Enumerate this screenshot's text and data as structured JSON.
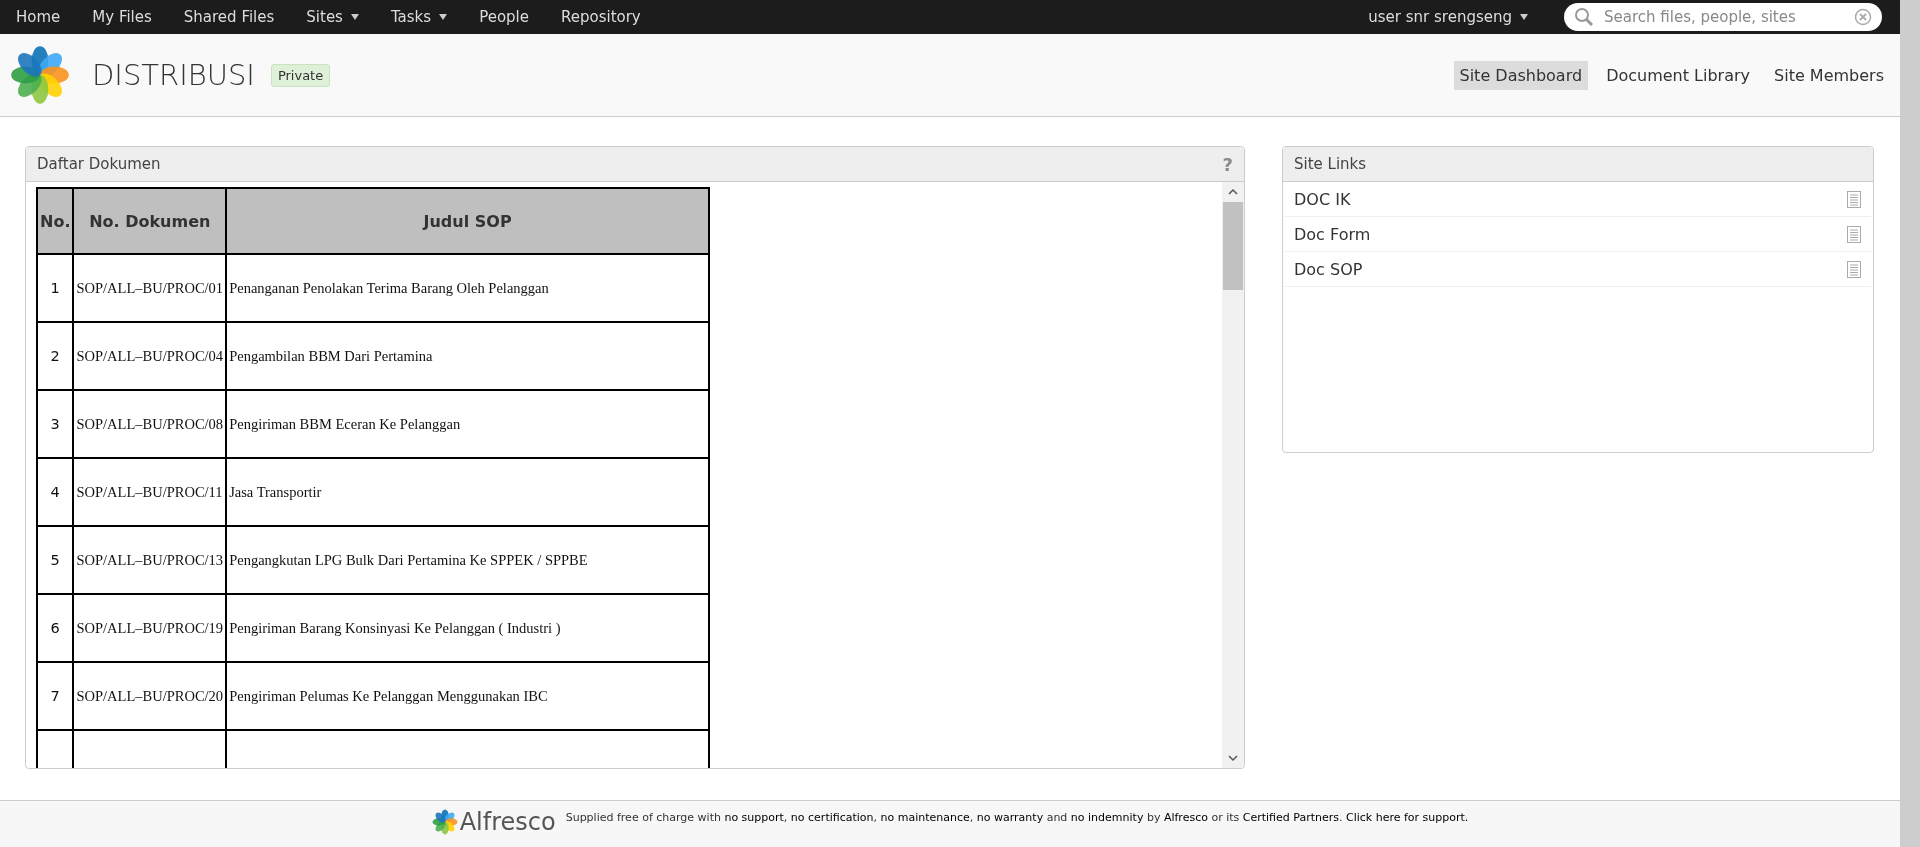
{
  "top_nav": {
    "items": [
      {
        "label": "Home",
        "dropdown": false
      },
      {
        "label": "My Files",
        "dropdown": false
      },
      {
        "label": "Shared Files",
        "dropdown": false
      },
      {
        "label": "Sites",
        "dropdown": true
      },
      {
        "label": "Tasks",
        "dropdown": true
      },
      {
        "label": "People",
        "dropdown": false
      },
      {
        "label": "Repository",
        "dropdown": false
      }
    ],
    "user": {
      "label": "user snr srengseng",
      "dropdown": true
    },
    "search": {
      "placeholder": "Search files, people, sites"
    }
  },
  "site_header": {
    "title": "DISTRIBUSI",
    "visibility": "Private",
    "nav": [
      {
        "label": "Site Dashboard",
        "selected": true
      },
      {
        "label": "Document Library",
        "selected": false
      },
      {
        "label": "Site Members",
        "selected": false
      }
    ]
  },
  "document_dashlet": {
    "title": "Daftar Dokumen",
    "help": "?",
    "table": {
      "columns": [
        "No.",
        "No. Dokumen",
        "Judul SOP"
      ],
      "rows": [
        {
          "no": "1",
          "doc": "SOP/ALL–BU/PROC/01",
          "title": "Penanganan Penolakan Terima Barang Oleh Pelanggan"
        },
        {
          "no": "2",
          "doc": "SOP/ALL–BU/PROC/04",
          "title": "Pengambilan BBM Dari Pertamina"
        },
        {
          "no": "3",
          "doc": "SOP/ALL–BU/PROC/08",
          "title": "Pengiriman BBM Eceran Ke Pelanggan"
        },
        {
          "no": "4",
          "doc": "SOP/ALL–BU/PROC/11",
          "title": "Jasa Transportir"
        },
        {
          "no": "5",
          "doc": "SOP/ALL–BU/PROC/13",
          "title": "Pengangkutan LPG Bulk Dari Pertamina Ke SPPEK / SPPBE"
        },
        {
          "no": "6",
          "doc": "SOP/ALL–BU/PROC/19",
          "title": "Pengiriman Barang Konsinyasi Ke Pelanggan ( Industri )"
        },
        {
          "no": "7",
          "doc": "SOP/ALL–BU/PROC/20",
          "title": "Pengiriman Pelumas Ke Pelanggan Menggunakan IBC"
        }
      ]
    }
  },
  "site_links": {
    "title": "Site Links",
    "links": [
      {
        "label": "DOC IK"
      },
      {
        "label": "Doc Form"
      },
      {
        "label": "Doc SOP"
      }
    ]
  },
  "footer": {
    "logo_text": "Alfresco",
    "notice": "Supplied free of charge with **no support**, **no certification**, **no maintenance**, **no warranty** and **no indemnity** by **Alfresco** or its **Certified Partners**. **Click here for support.**"
  }
}
